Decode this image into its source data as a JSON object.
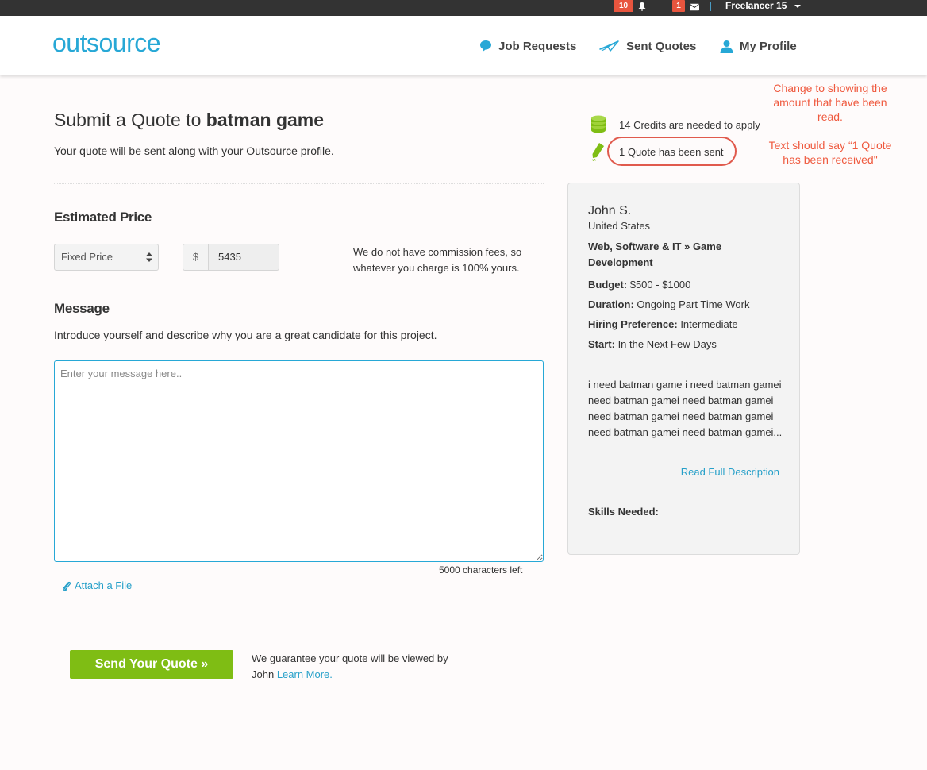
{
  "topbar": {
    "notifications_count": "10",
    "messages_count": "1",
    "username": "Freelancer 15"
  },
  "header": {
    "logo": "outsource",
    "nav": [
      {
        "label": "Job Requests",
        "icon": "speech-bubble-icon"
      },
      {
        "label": "Sent Quotes",
        "icon": "paper-plane-icon"
      },
      {
        "label": "My Profile",
        "icon": "user-icon"
      }
    ]
  },
  "form": {
    "title_prefix": "Submit a Quote to ",
    "title_job": "batman game",
    "subtitle": "Your quote will be sent along with your Outsource profile.",
    "estimated_price_heading": "Estimated Price",
    "price_type": "Fixed Price",
    "currency_symbol": "$",
    "price_value": "5435",
    "fee_note": "We do not have commission fees, so whatever you charge is 100% yours.",
    "message_heading": "Message",
    "message_intro": "Introduce yourself and describe why you are a great candidate for this project.",
    "message_placeholder": "Enter your message here..",
    "chars_left": "5000 characters left",
    "attach_label": "Attach a File",
    "send_label": "Send Your Quote »",
    "guarantee_text": "We guarantee your quote will be viewed by John ",
    "learn_more": "Learn More."
  },
  "stats": {
    "credits": "14 Credits are needed to apply",
    "quotes": "1 Quote has been sent"
  },
  "annotations": {
    "note_1": "Change to showing the amount that have been read.",
    "note_2": "Text should say “1 Quote has been received\""
  },
  "job_card": {
    "client_name": "John S.",
    "country": "United States",
    "category": "Web, Software & IT » Game Development",
    "budget_label": "Budget:",
    "budget_value": " $500 - $1000",
    "duration_label": "Duration:",
    "duration_value": " Ongoing Part Time Work",
    "hiring_label": "Hiring Preference:",
    "hiring_value": " Intermediate",
    "start_label": "Start:",
    "start_value": " In the Next Few Days",
    "description": "i need batman game i need batman gamei need batman gamei need batman gamei need batman gamei need batman gamei need batman gamei need batman gamei...",
    "read_full": "Read Full Description",
    "skills_label": "Skills Needed:"
  },
  "colors": {
    "brand_blue": "#27a8d6",
    "send_green": "#7fbd14",
    "badge_red": "#e8553e",
    "annotation_red": "#ef5a3f",
    "topbar_bg": "#333333"
  }
}
